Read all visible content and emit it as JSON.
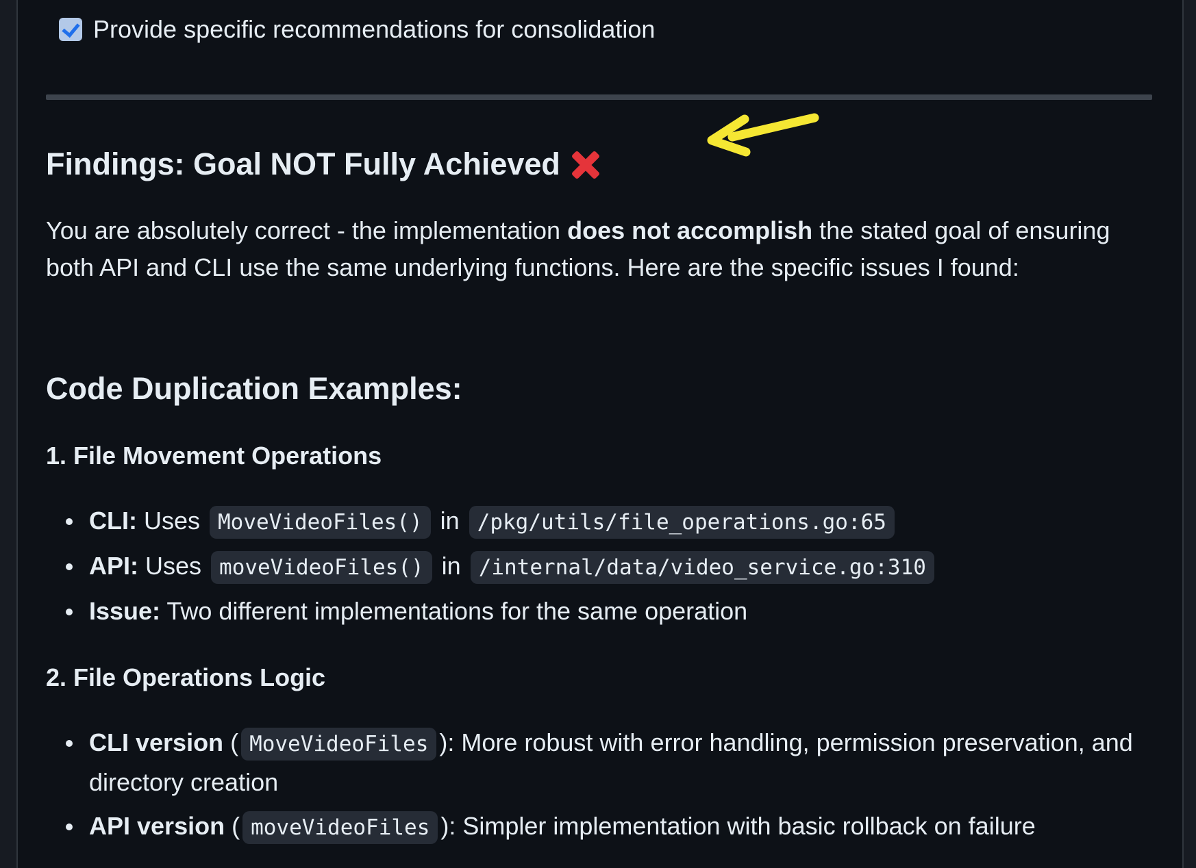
{
  "task": {
    "checked": true,
    "label": "Provide specific recommendations for consolidation"
  },
  "findings": {
    "title": "Findings: Goal NOT Fully Achieved",
    "status_icon": "cross-mark-icon",
    "intro_before": "You are absolutely correct - the implementation ",
    "intro_bold": "does not accomplish",
    "intro_after": " the stated goal of ensuring both API and CLI use the same underlying functions. Here are the specific issues I found:"
  },
  "annotation": {
    "arrow_color": "#f5e733"
  },
  "duplication": {
    "title": "Code Duplication Examples:",
    "sections": [
      {
        "title": "1. File Movement Operations",
        "items": [
          {
            "label": "CLI:",
            "text_a": " Uses ",
            "code_a": "MoveVideoFiles()",
            "text_b": " in ",
            "code_b": "/pkg/utils/file_operations.go:65"
          },
          {
            "label": "API:",
            "text_a": " Uses ",
            "code_a": "moveVideoFiles()",
            "text_b": " in ",
            "code_b": "/internal/data/video_service.go:310"
          },
          {
            "label": "Issue:",
            "text_a": " Two different implementations for the same operation"
          }
        ]
      },
      {
        "title": "2. File Operations Logic",
        "items": [
          {
            "label": "CLI version",
            "text_a": " (",
            "code_a": "MoveVideoFiles",
            "text_b": "): More robust with error handling, permission preservation, and directory creation"
          },
          {
            "label": "API version",
            "text_a": " (",
            "code_a": "moveVideoFiles",
            "text_b": "): Simpler implementation with basic rollback on failure"
          }
        ]
      }
    ]
  }
}
